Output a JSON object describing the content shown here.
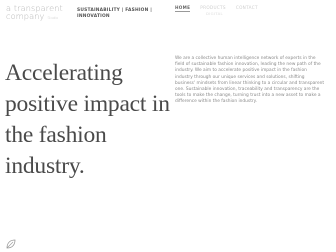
{
  "header": {
    "logo": {
      "line1": "a transparent",
      "line2": "company",
      "tag": "Studio"
    },
    "tagline": {
      "line1": "SUSTAINABILITY | FASHION |",
      "line2": "INNOVATION"
    },
    "nav": {
      "items": [
        {
          "label": "HOME"
        },
        {
          "label": "PRODUCTS"
        },
        {
          "label": "CONTACT"
        }
      ],
      "sub_label": "DIGITAL"
    }
  },
  "hero": {
    "title": "Accelerating positive impact in the fashion industry."
  },
  "intro": {
    "text": "We are a collective human intelligence network of experts in the field of sustainable fashion innovation, leading the new path of the industry. We aim to accelerate positive impact in the fashion industry through our unique services and solutions, shifting business' mindsets from linear thinking to a circular and transparent one. Sustainable innovation, traceability and transparency are the tools to make the change, turning trust into a new asset to make a difference within the fashion industry."
  },
  "icons": {
    "bottom_left": "leaf-icon"
  }
}
